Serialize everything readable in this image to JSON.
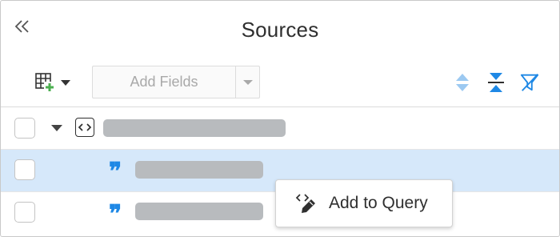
{
  "panel": {
    "title": "Sources",
    "collapse_icon": "double-chevron-left-icon"
  },
  "toolbar": {
    "table_icon": "table-add-icon",
    "add_fields_label": "Add Fields",
    "tools": [
      "sort-icon",
      "collapse-all-icon",
      "filter-off-icon"
    ]
  },
  "tree": {
    "rows": [
      {
        "kind": "code",
        "expanded": true,
        "selected": false
      },
      {
        "kind": "string",
        "selected": true
      },
      {
        "kind": "string",
        "selected": false
      }
    ]
  },
  "popup": {
    "label": "Add to Query",
    "icon": "code-pencil-icon"
  },
  "colors": {
    "accent": "#1e88e5",
    "selected_row": "#d6e8fa",
    "placeholder": "#b8bbbe",
    "plus_green": "#4caf50"
  }
}
